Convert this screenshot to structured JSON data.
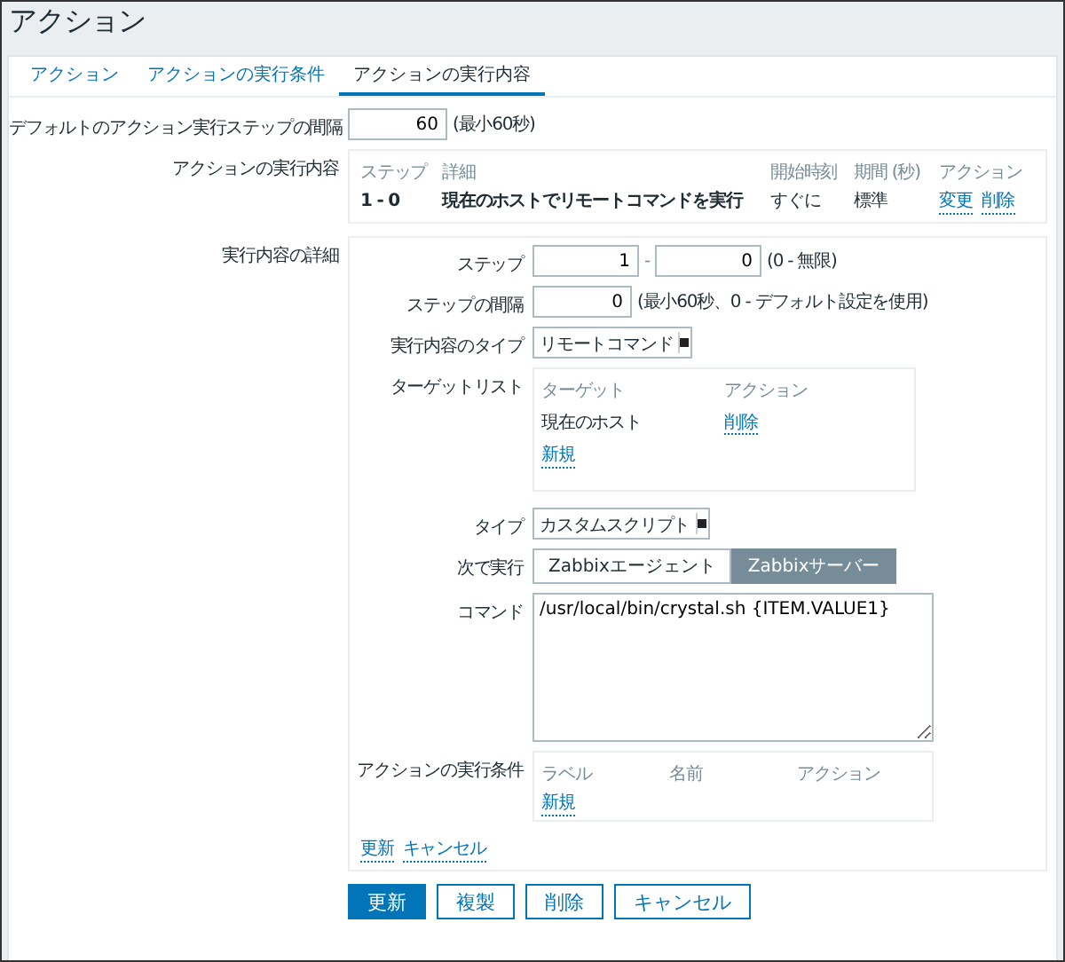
{
  "title": "アクション",
  "tabs": [
    {
      "label": "アクション",
      "selected": false
    },
    {
      "label": "アクションの実行条件",
      "selected": false
    },
    {
      "label": "アクションの実行内容",
      "selected": true
    }
  ],
  "default_step": {
    "label": "デフォルトのアクション実行ステップの間隔",
    "value": "60",
    "hint": "(最小60秒)"
  },
  "operations": {
    "label": "アクションの実行内容",
    "columns": [
      "ステップ",
      "詳細",
      "開始時刻",
      "期間 (秒)",
      "アクション"
    ],
    "rows": [
      {
        "steps": "1 - 0",
        "details": "現在のホストでリモートコマンドを実行",
        "start": "すぐに",
        "duration": "標準",
        "links": [
          "変更",
          "削除"
        ]
      }
    ]
  },
  "details": {
    "label": "実行内容の詳細",
    "step": {
      "label": "ステップ",
      "from": "1",
      "separator": "-",
      "to": "0",
      "hint": "(0 - 無限)"
    },
    "step_interval": {
      "label": "ステップの間隔",
      "value": "0",
      "hint": "(最小60秒、0 - デフォルト設定を使用)"
    },
    "operation_type": {
      "label": "実行内容のタイプ",
      "value": "リモートコマンド"
    },
    "target_list": {
      "label": "ターゲットリスト",
      "columns": [
        "ターゲット",
        "アクション"
      ],
      "rows": [
        {
          "target": "現在のホスト",
          "action": "削除"
        }
      ],
      "add": "新規"
    },
    "type": {
      "label": "タイプ",
      "value": "カスタムスクリプト"
    },
    "execute_on": {
      "label": "次で実行",
      "options": [
        {
          "label": "Zabbixエージェント",
          "selected": false
        },
        {
          "label": "Zabbixサーバー",
          "selected": true
        }
      ]
    },
    "command": {
      "label": "コマンド",
      "value": "/usr/local/bin/crystal.sh {ITEM.VALUE1}"
    },
    "conditions": {
      "label": "アクションの実行条件",
      "columns": [
        "ラベル",
        "名前",
        "アクション"
      ],
      "add": "新規"
    },
    "links": [
      "更新",
      "キャンセル"
    ]
  },
  "buttons": [
    {
      "label": "更新",
      "kind": "primary"
    },
    {
      "label": "複製",
      "kind": "secondary"
    },
    {
      "label": "削除",
      "kind": "secondary"
    },
    {
      "label": "キャンセル",
      "kind": "secondary"
    }
  ]
}
